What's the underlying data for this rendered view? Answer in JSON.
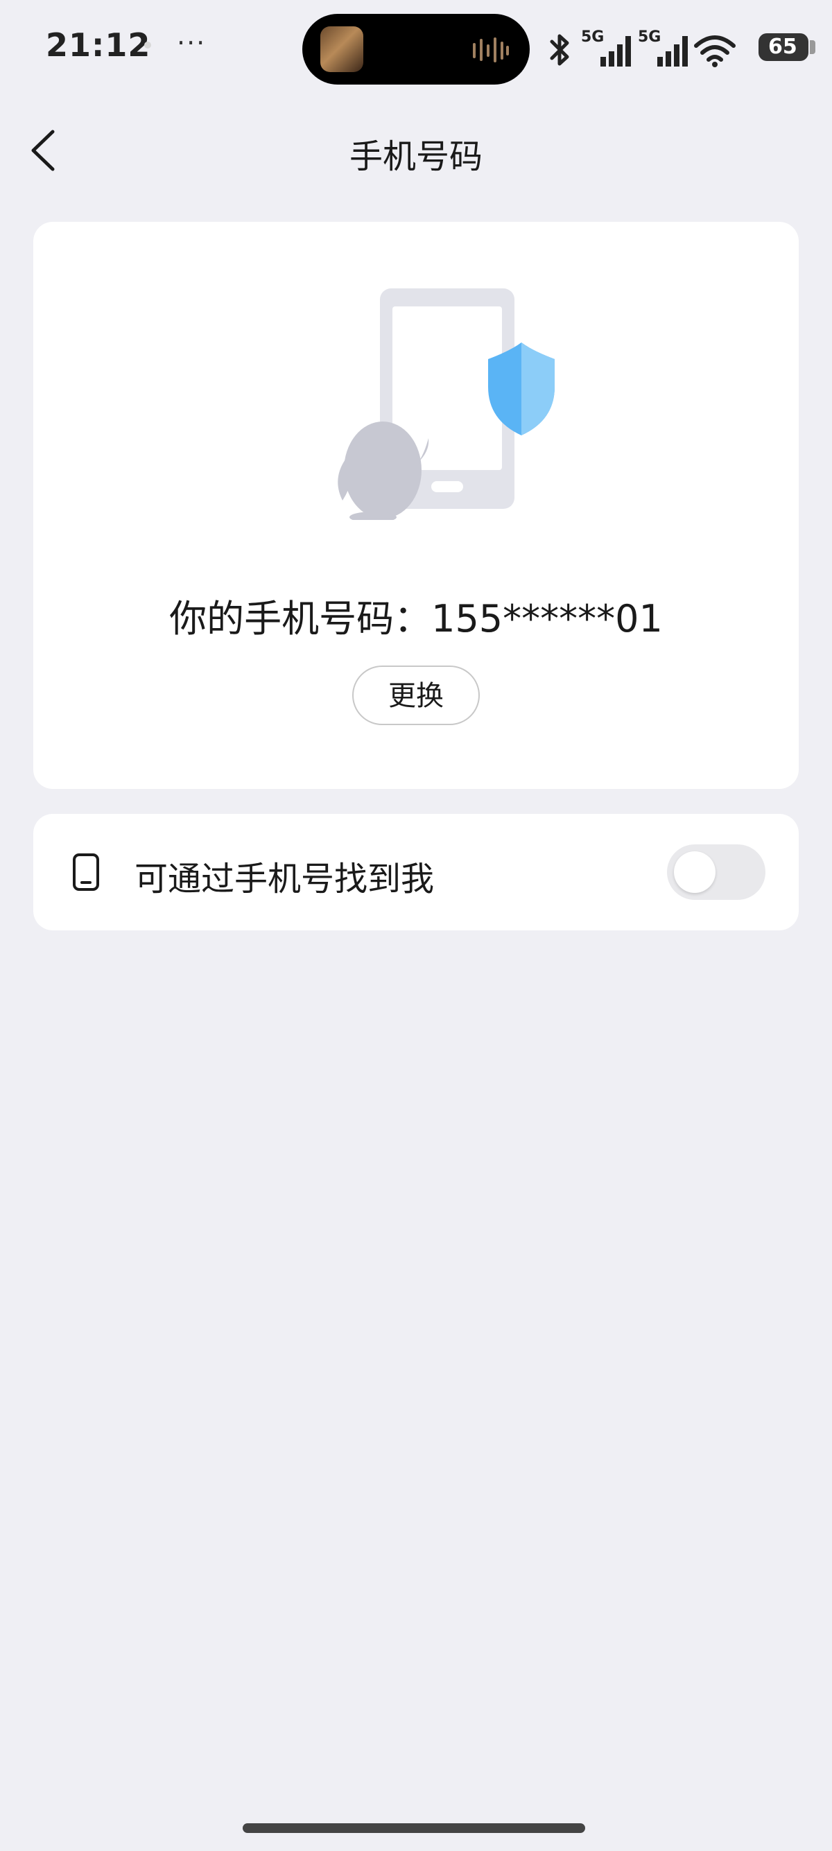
{
  "status_bar": {
    "time": "21:12",
    "more": "···",
    "net1": "5G",
    "net2": "5G",
    "battery": "65"
  },
  "nav": {
    "title": "手机号码"
  },
  "phone_card": {
    "phone_text": "你的手机号码：155******01",
    "change_label": "更换"
  },
  "find_setting": {
    "label": "可通过手机号找到我",
    "enabled": false
  },
  "colors": {
    "background": "#efeff4",
    "card": "#ffffff",
    "shield": "#5ab4f5",
    "illustration_gray": "#c7c8d2"
  },
  "icons": {
    "back": "chevron-left-icon",
    "phone": "phone-icon",
    "bluetooth": "bluetooth-icon",
    "signal": "signal-icon",
    "wifi": "wifi-icon",
    "shield": "shield-icon",
    "mascot": "penguin-icon"
  }
}
